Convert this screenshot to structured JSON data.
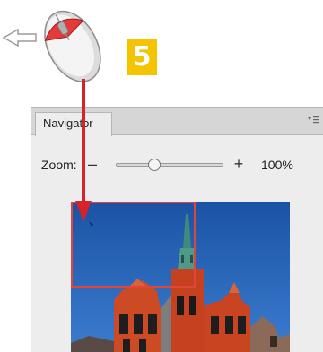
{
  "step": {
    "number": "5"
  },
  "navigator": {
    "tab_label": "Navigator",
    "menu_icon": "panel-menu-icon",
    "zoom": {
      "label": "Zoom:",
      "minus": "–",
      "plus": "+",
      "value_text": "100%",
      "slider_level": 0.36
    },
    "view_box_color": "#e0443a"
  },
  "icons": {
    "mouse": "mouse-icon",
    "drag_left": "arrow-left-icon",
    "drag_down": "arrow-down-icon"
  },
  "colors": {
    "badge": "#f5c400",
    "arrow": "#d6222b",
    "sky": "#1f5ba8",
    "building": "#c9431f"
  }
}
